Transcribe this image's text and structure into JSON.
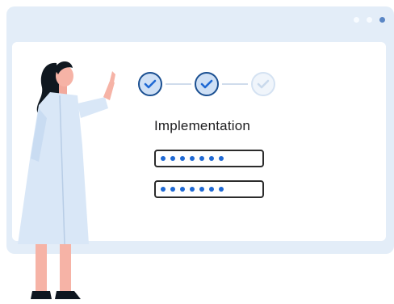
{
  "colors": {
    "window_bg": "#e3edf8",
    "title_dot": "#f7fbff",
    "title_dot_active": "#5a86c5",
    "accent": "#1f69d4",
    "step_done_fill": "#cfe0f5",
    "step_done_border": "#1a4f91",
    "step_todo": "#d4e2f2"
  },
  "window": {
    "controls": [
      "window-dot",
      "window-dot",
      "window-dot-active"
    ]
  },
  "progress": {
    "steps": [
      {
        "state": "done",
        "icon": "checkmark-icon"
      },
      {
        "state": "done",
        "icon": "checkmark-icon"
      },
      {
        "state": "pending",
        "icon": "checkmark-icon"
      }
    ]
  },
  "main": {
    "title": "Implementation",
    "fields": [
      {
        "mask": "●●●●●●●",
        "dot_count": 7
      },
      {
        "mask": "●●●●●●●",
        "dot_count": 7
      }
    ]
  },
  "illustration": {
    "icon": "woman-pointing-illustration"
  }
}
